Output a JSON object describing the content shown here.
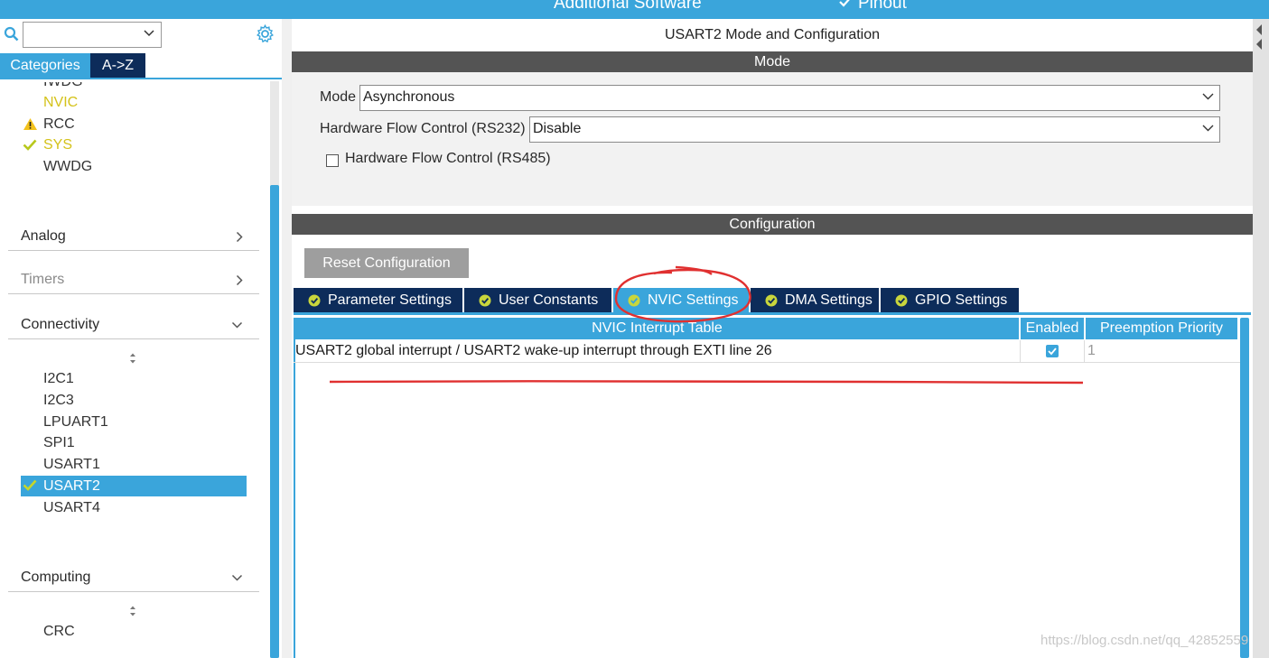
{
  "topbar": {
    "left_text": "Additional Software",
    "right_text": "Pinout"
  },
  "sidebar": {
    "search": {
      "value": ""
    },
    "tabs": [
      "Categories",
      "A->Z"
    ],
    "system_items": [
      {
        "label": "IWDG",
        "status": "",
        "color": "default"
      },
      {
        "label": "NVIC",
        "status": "",
        "color": "yellow"
      },
      {
        "label": "RCC",
        "status": "warning",
        "color": "default"
      },
      {
        "label": "SYS",
        "status": "ok",
        "color": "yellow"
      },
      {
        "label": "WWDG",
        "status": "",
        "color": "default"
      }
    ],
    "sections": {
      "analog": "Analog",
      "timers": "Timers",
      "connectivity": "Connectivity",
      "computing": "Computing"
    },
    "connectivity_items": [
      "I2C1",
      "I2C3",
      "LPUART1",
      "SPI1",
      "USART1",
      "USART2",
      "USART4"
    ],
    "selected_item": "USART2",
    "computing_items": [
      "CRC"
    ]
  },
  "main": {
    "title": "USART2 Mode and Configuration",
    "mode_header": "Mode",
    "mode": {
      "label": "Mode",
      "value": "Asynchronous"
    },
    "hw_flow_rs232": {
      "label": "Hardware Flow Control (RS232)",
      "value": "Disable"
    },
    "hw_flow_rs485": {
      "label": "Hardware Flow Control (RS485)",
      "checked": false
    },
    "config_header": "Configuration",
    "reset_button": "Reset Configuration",
    "tabs": [
      "Parameter Settings",
      "User Constants",
      "NVIC Settings",
      "DMA Settings",
      "GPIO Settings"
    ],
    "active_tab": "NVIC Settings",
    "nvic_table": {
      "headers": [
        "NVIC Interrupt Table",
        "Enabled",
        "Preemption Priority"
      ],
      "rows": [
        {
          "name": "USART2 global interrupt / USART2 wake-up interrupt through EXTI line 26",
          "enabled": true,
          "priority": "1"
        }
      ]
    }
  },
  "watermark": "https://blog.csdn.net/qq_42852559",
  "colors": {
    "accent": "#3aa5db",
    "tab_dark": "#0d2c5a",
    "header_dark": "#545454",
    "annotation": "#e03030"
  }
}
